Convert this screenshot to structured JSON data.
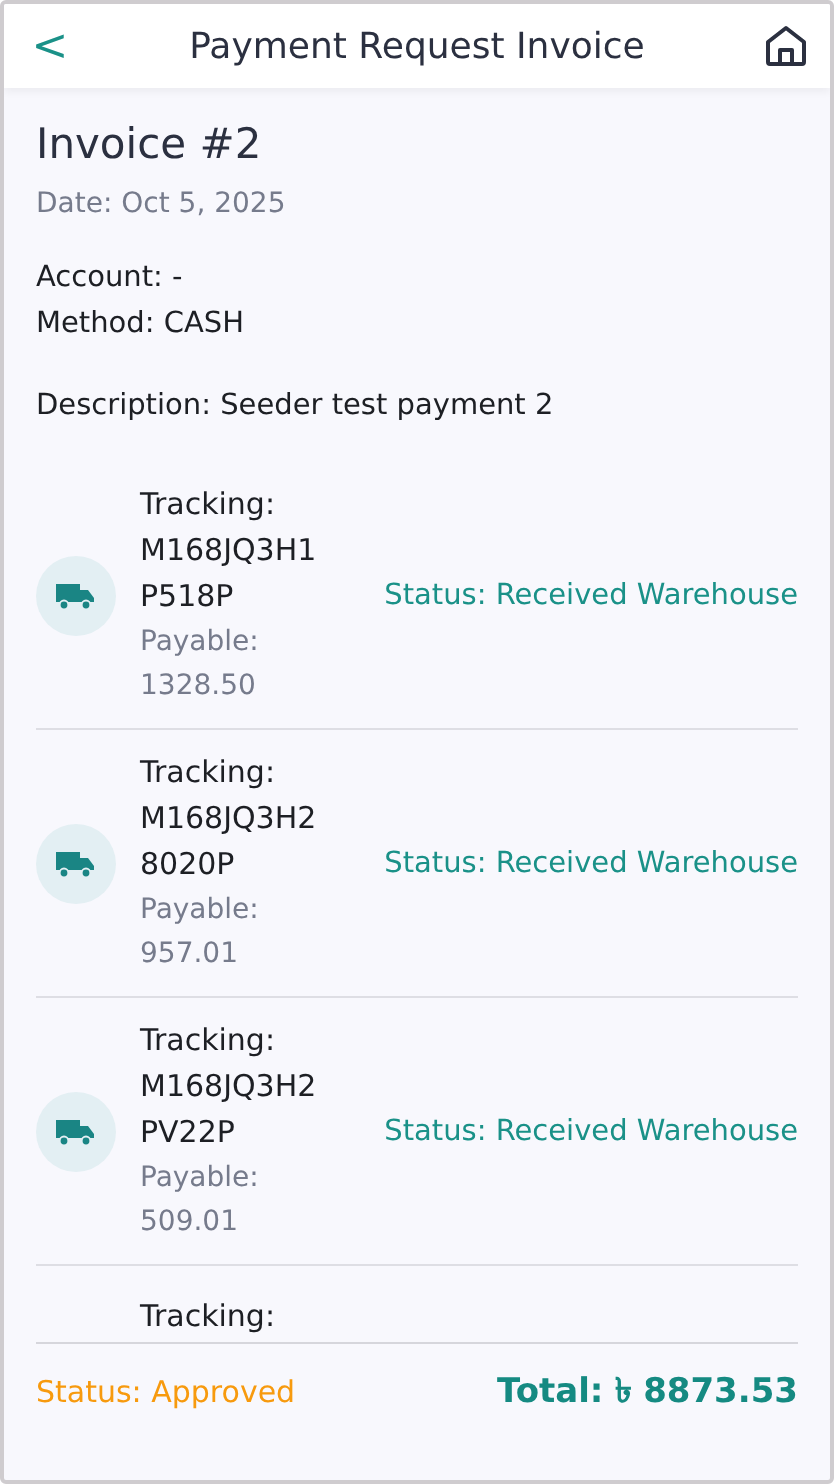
{
  "header": {
    "back": "<",
    "title": "Payment Request Invoice"
  },
  "invoice": {
    "title": "Invoice #2",
    "date": "Date: Oct 5, 2025",
    "account": "Account: -",
    "method": "Method: CASH",
    "description": "Description: Seeder test payment 2"
  },
  "shipments": [
    {
      "tracking_label": "Tracking:",
      "tracking": "M168JQ3H1P518P",
      "payable_label": "Payable:",
      "payable": "1328.50",
      "status": "Status: Received Warehouse"
    },
    {
      "tracking_label": "Tracking:",
      "tracking": "M168JQ3H28020P",
      "payable_label": "Payable:",
      "payable": "957.01",
      "status": "Status: Received Warehouse"
    },
    {
      "tracking_label": "Tracking:",
      "tracking": "M168JQ3H2PV22P",
      "payable_label": "Payable:",
      "payable": "509.01",
      "status": "Status: Received Warehouse"
    },
    {
      "tracking_label": "Tracking:"
    }
  ],
  "footer": {
    "status": "Status: Approved",
    "total": "Total: ৳ 8873.53"
  }
}
